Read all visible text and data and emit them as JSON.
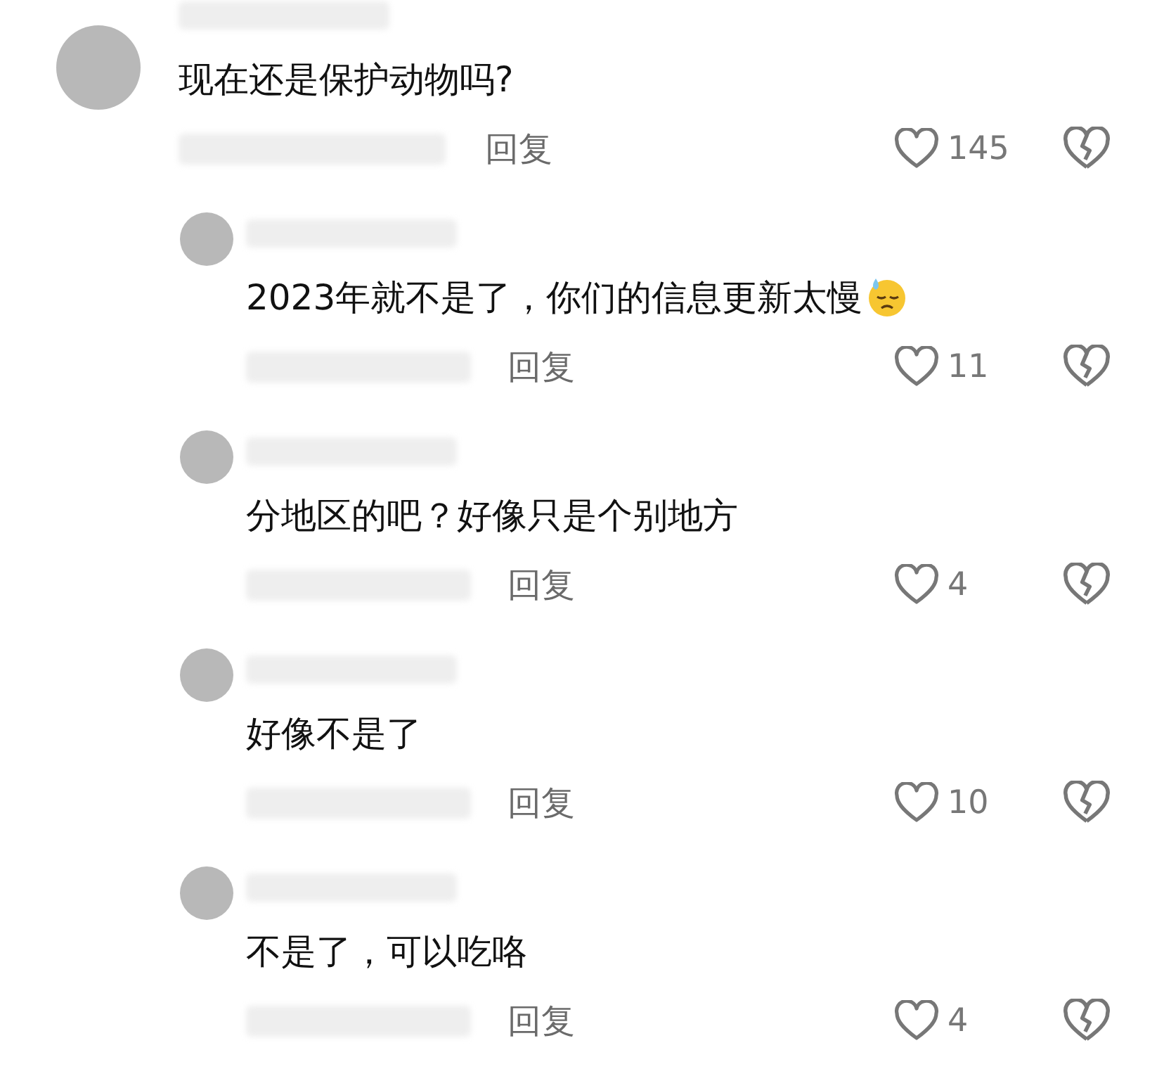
{
  "comments": [
    {
      "text": "现在还是保护动物吗?",
      "reply_label": "回复",
      "likes": "145",
      "replies": [
        {
          "text": "2023年就不是了，你们的信息更新太慢",
          "trailing_emoji": true,
          "reply_label": "回复",
          "likes": "11"
        },
        {
          "text": "分地区的吧？好像只是个别地方",
          "reply_label": "回复",
          "likes": "4"
        },
        {
          "text": "好像不是了",
          "reply_label": "回复",
          "likes": "10"
        },
        {
          "text": "不是了，可以吃咯",
          "reply_label": "回复",
          "likes": "4"
        }
      ]
    }
  ]
}
